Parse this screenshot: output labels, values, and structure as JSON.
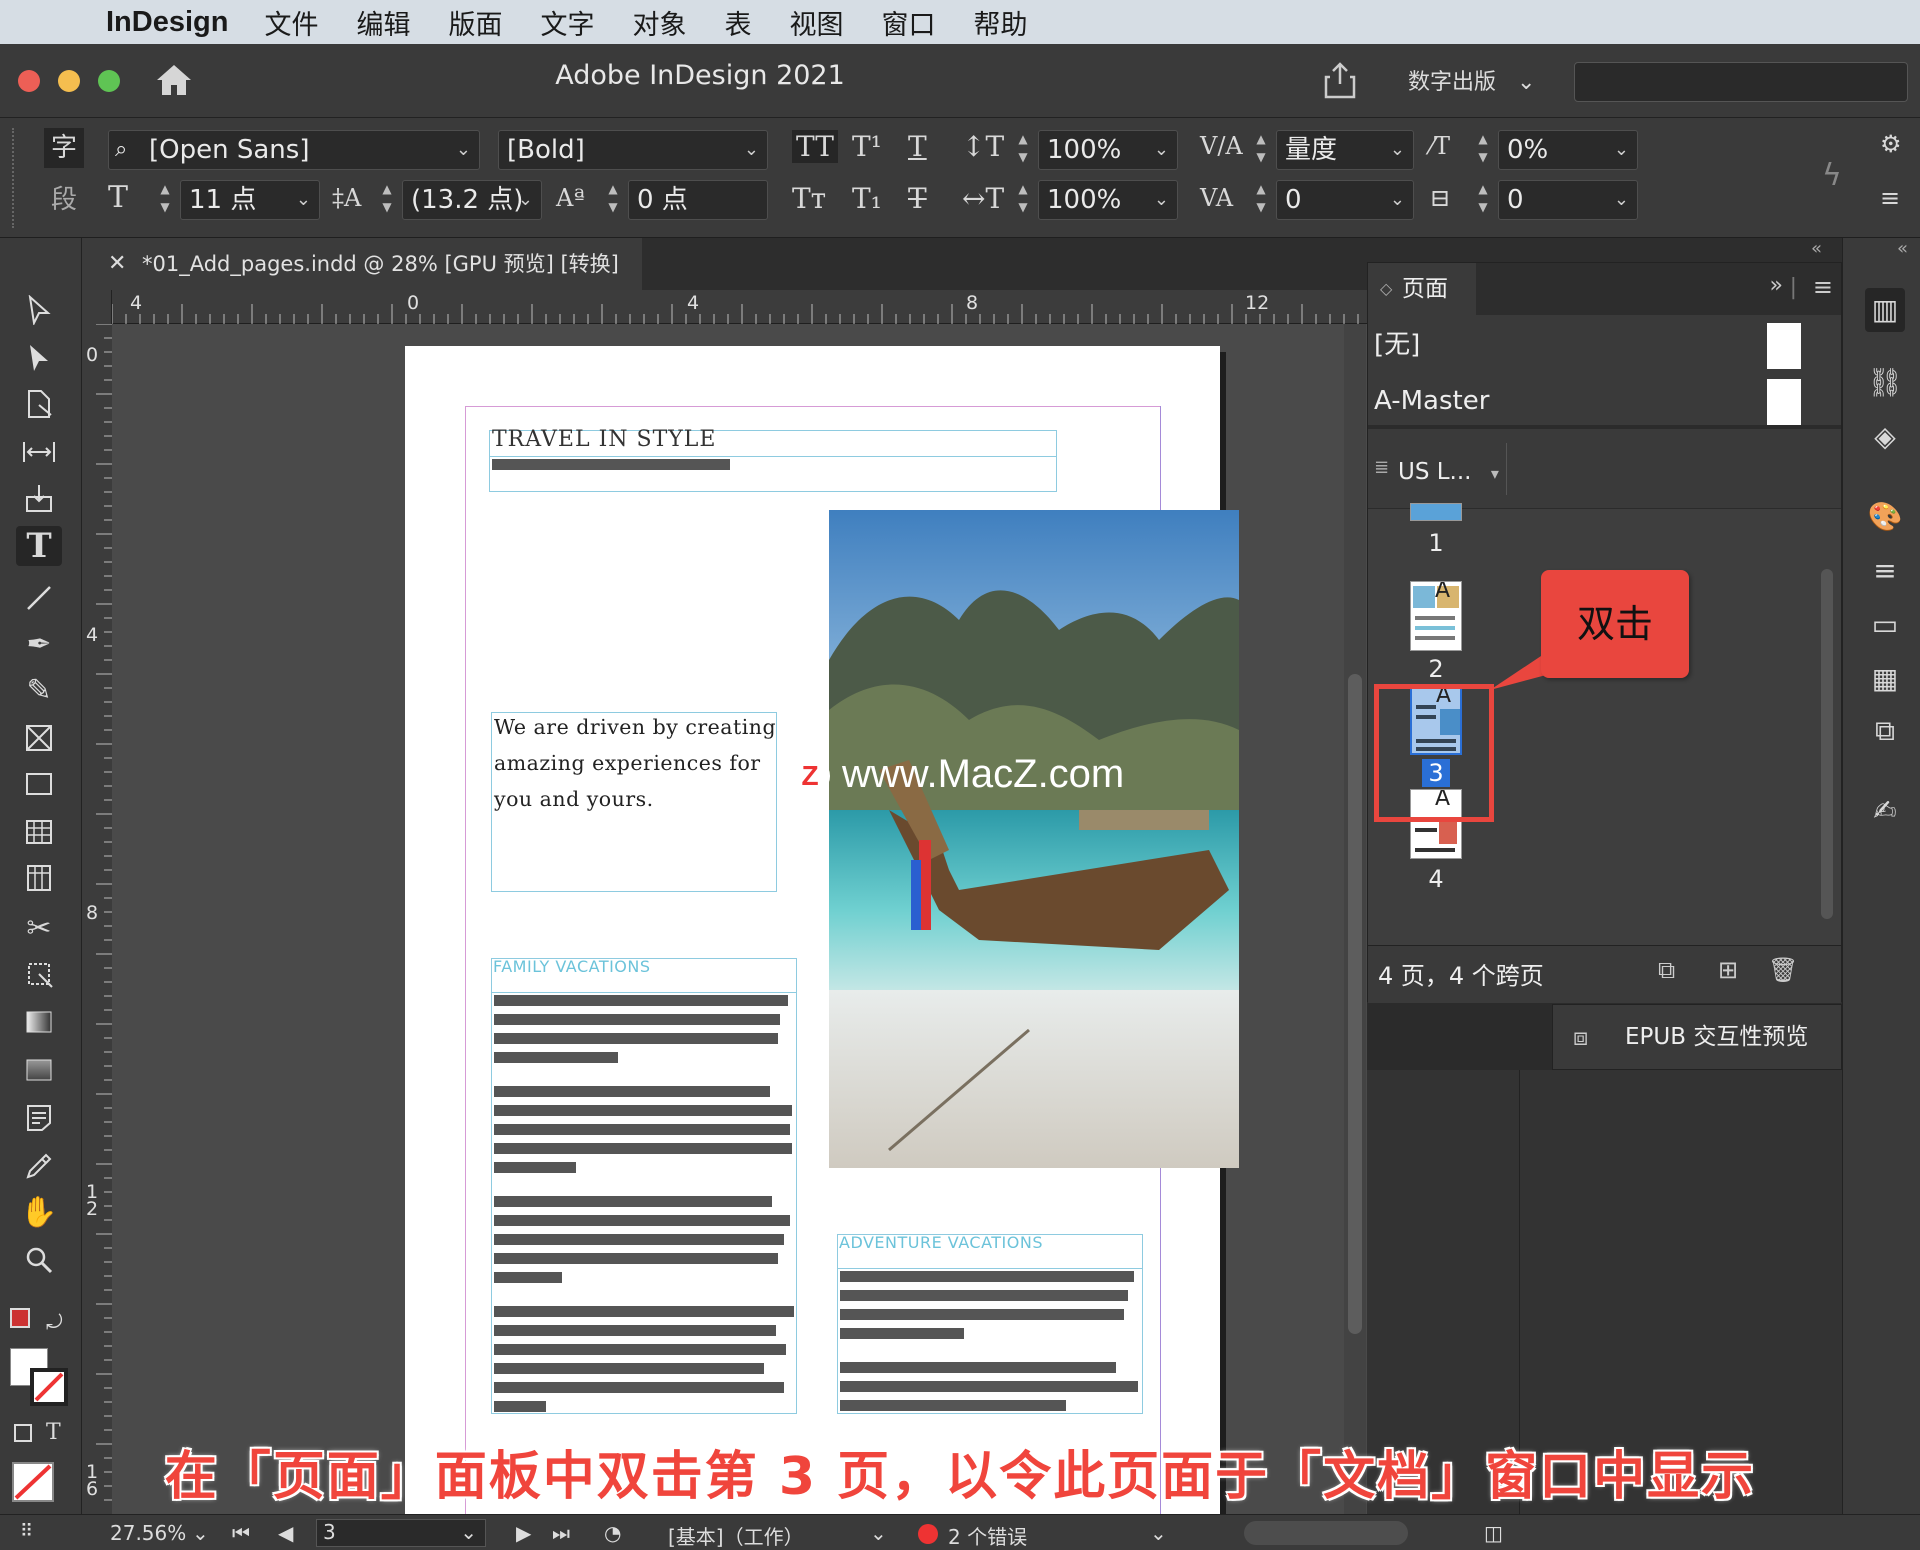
{
  "menubar": {
    "app_name": "InDesign",
    "items": [
      "文件",
      "编辑",
      "版面",
      "文字",
      "对象",
      "表",
      "视图",
      "窗口",
      "帮助"
    ]
  },
  "titlebar": {
    "title": "Adobe InDesign 2021",
    "workspace": "数字出版"
  },
  "control_panel": {
    "char_mode": "字",
    "para_mode": "段",
    "font_family": "[Open Sans]",
    "font_style": "[Bold]",
    "font_size": "11 点",
    "leading": "(13.2 点)",
    "baseline_shift": "0 点",
    "vertical_scale": "100%",
    "horizontal_scale": "100%",
    "kerning": "量度",
    "tracking": "0",
    "skew": "0%",
    "rotate": "0"
  },
  "document": {
    "tab_title": "*01_Add_pages.indd @ 28% [GPU 预览] [转换]",
    "ruler_h": [
      "4",
      "0",
      "4",
      "8",
      "12"
    ],
    "ruler_v": [
      "0",
      "4",
      "8",
      "1\n2",
      "1\n6"
    ],
    "page": {
      "heading": "TRAVEL IN STYLE",
      "body": "We are driven by creating amazing experiences for you and yours.",
      "family_heading": "FAMILY VACATIONS",
      "adventure_heading": "ADVENTURE VACATIONS"
    }
  },
  "watermark": "www.MacZ.com",
  "pages_panel": {
    "tab_label": "页面",
    "masters": [
      "[无]",
      "A-Master"
    ],
    "page_size": "US L...",
    "pages": [
      "1",
      "2",
      "3",
      "4"
    ],
    "selected_page": "3",
    "status": "4 页，4 个跨页"
  },
  "callout": "双击",
  "epub_panel": {
    "label": "EPUB 交互性预览"
  },
  "statusbar": {
    "zoom": "27.56%",
    "page": "3",
    "profile": "[基本]（工作）",
    "errors": "2 个错误"
  },
  "subtitle": "在「页面」面板中双击第 3 页，以令此页面于「文档」窗口中显示",
  "colors": {
    "accent_red": "#e9463e",
    "selection_blue": "#2a6fd6",
    "frame_cyan": "#8ecbe0"
  }
}
